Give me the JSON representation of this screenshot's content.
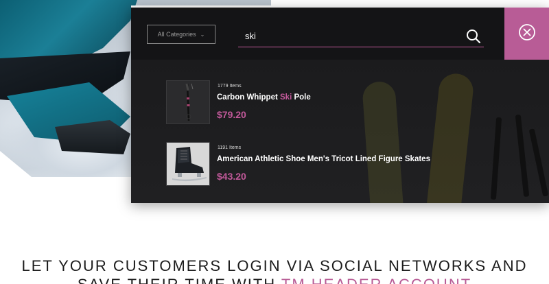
{
  "search": {
    "category_label": "All Categories",
    "query": "ski"
  },
  "results": [
    {
      "count": "1779 Items",
      "title_before": "Carbon Whippet ",
      "title_highlight": "Ski",
      "title_after": " Pole",
      "price": "$79.20",
      "thumb_icon": "ski-pole-icon"
    },
    {
      "count": "1191 Items",
      "title_before": "American Athletic Shoe Men's Tricot Lined Figure Skates",
      "title_highlight": "",
      "title_after": "",
      "price": "$43.20",
      "thumb_icon": "figure-skate-icon"
    }
  ],
  "headline": {
    "line1": "LET YOUR CUSTOMERS LOGIN VIA SOCIAL NETWORKS AND",
    "line2_before": "SAVE THEIR TIME WITH ",
    "line2_accent": "TM HEADER ACCOUNT"
  },
  "colors": {
    "accent": "#c2599a",
    "close_block": "#b85c96",
    "panel": "#1a1a1c"
  }
}
